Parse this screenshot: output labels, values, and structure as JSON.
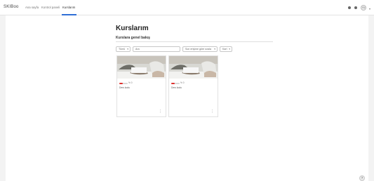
{
  "navbar": {
    "brand": "SKIBoo",
    "links": [
      {
        "label": "Ana sayfa"
      },
      {
        "label": "Kontrol paneli"
      },
      {
        "label": "Kurslarım"
      }
    ]
  },
  "user": {
    "initials": "YU"
  },
  "page": {
    "title": "Kurslarım",
    "section_title": "Kurslara genel bakış"
  },
  "filters": {
    "grouping": "Tümü",
    "search_placeholder": "Ara",
    "sort": "Son erişime göre sırala",
    "view": "Kart"
  },
  "courses": [
    {
      "title": "Ders kodu",
      "progress_text": "% 0",
      "progress": 0.4
    },
    {
      "title": "Ders kodu",
      "progress_text": "% 0",
      "progress": 0.4
    }
  ],
  "help": {
    "label": "?"
  },
  "colors": {
    "accent": "#2f6fd6",
    "progress": "#e0312f"
  }
}
